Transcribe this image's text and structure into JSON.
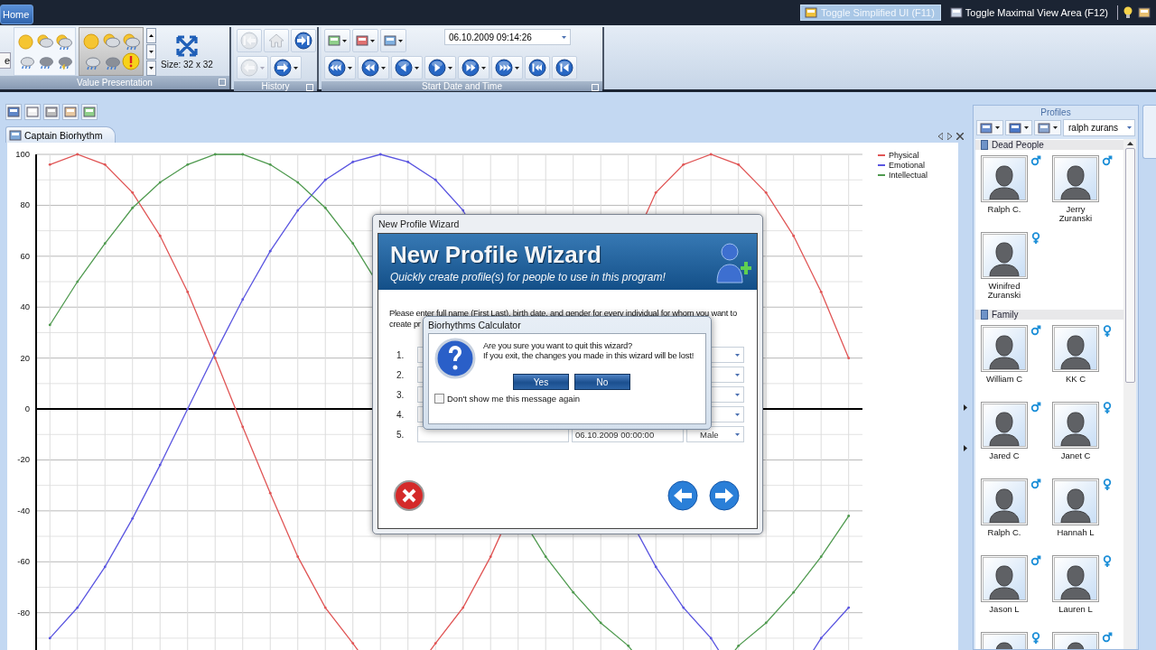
{
  "top_bar": {
    "home_tab": "Home",
    "toggle_simplified": "Toggle Simplified UI (F11)",
    "toggle_maximal": "Toggle Maximal View Area (F12)"
  },
  "ribbon": {
    "cut_button": "e",
    "value_presentation": {
      "label": "Value Presentation",
      "gallery": [
        {
          "selected": false
        },
        {
          "selected": true
        }
      ],
      "size": "Size: 32 x 32"
    },
    "history": {
      "label": "History",
      "buttons": [
        {
          "kind": "to-start",
          "disabled": true
        },
        {
          "kind": "home",
          "disabled": true
        },
        {
          "kind": "to-end",
          "disabled": false
        },
        {
          "kind": "back",
          "disabled": true
        },
        {
          "kind": "forward",
          "disabled": false
        }
      ]
    },
    "start_date_time": {
      "label": "Start Date and Time",
      "datetime": "06.10.2009 09:14:26"
    }
  },
  "document": {
    "tab": "Captain Biorhythm",
    "chart_data": {
      "type": "line",
      "categories": [
        null,
        null,
        null,
        null,
        null,
        null,
        null,
        null,
        null,
        null,
        null,
        null,
        null,
        null,
        null,
        null,
        null,
        null,
        null,
        null,
        null,
        null,
        null,
        null,
        null,
        null,
        null,
        null,
        null,
        null
      ],
      "ylim": [
        -95,
        100
      ],
      "yticks": [
        -80,
        -60,
        -40,
        -20,
        0,
        20,
        40,
        60,
        80,
        100
      ],
      "grid": true,
      "series": [
        {
          "name": "Physical",
          "color": "#e05555",
          "values": [
            96,
            100,
            96,
            85,
            68,
            46,
            20,
            -7,
            -33,
            -58,
            -78,
            -92,
            null,
            null,
            -92,
            -78,
            -58,
            null,
            null,
            null,
            null,
            null,
            85,
            96,
            100,
            96,
            85,
            68,
            46,
            20
          ]
        },
        {
          "name": "Emotional",
          "color": "#5a55e0",
          "values": [
            -90,
            -78,
            -62,
            -43,
            -22,
            0,
            22,
            43,
            62,
            78,
            90,
            97,
            100,
            97,
            90,
            78,
            null,
            null,
            null,
            null,
            null,
            null,
            -62,
            -78,
            -90,
            null,
            null,
            null,
            -90,
            -78
          ]
        },
        {
          "name": "Intellectual",
          "color": "#4f9a4f",
          "values": [
            33,
            50,
            65,
            79,
            89,
            96,
            100,
            100,
            96,
            89,
            79,
            65,
            null,
            null,
            null,
            null,
            null,
            null,
            -58,
            -72,
            -84,
            -93,
            null,
            null,
            null,
            -93,
            -84,
            -72,
            -58,
            -42
          ]
        }
      ]
    }
  },
  "profiles": {
    "title": "Profiles",
    "search": "ralph zurans",
    "groups": [
      {
        "name": "Dead People",
        "people": [
          {
            "name": "Ralph C.",
            "kind": "male"
          },
          {
            "name": "Jerry Zuranski",
            "kind": "male"
          },
          {
            "name": "Winifred Zuranski",
            "kind": "female"
          }
        ]
      },
      {
        "name": "Family",
        "people": [
          {
            "name": "William C",
            "kind": "male"
          },
          {
            "name": "KK C",
            "kind": "female"
          },
          {
            "name": "Jared C",
            "kind": "male"
          },
          {
            "name": "Janet C",
            "kind": "female"
          },
          {
            "name": "Ralph C.",
            "kind": "male"
          },
          {
            "name": "Hannah L",
            "kind": "female"
          },
          {
            "name": "Jason L",
            "kind": "male"
          },
          {
            "name": "Lauren L",
            "kind": "female"
          },
          {
            "kind": "female"
          },
          {
            "kind": "male"
          }
        ]
      }
    ]
  },
  "wizard": {
    "window_title": "New Profile Wizard",
    "heading": "New Profile Wizard",
    "subtitle": "Quickly create profile(s) for people to use in this program!",
    "instruction": [
      "Please enter full name (First Last), birth date, and gender for every individual for whom you want to",
      "create pr"
    ],
    "rows": [
      {
        "number": "1."
      },
      {
        "number": "2."
      },
      {
        "number": "3."
      },
      {
        "number": "4."
      },
      {
        "number": "5.",
        "date": "06.10.2009 00:00:00",
        "gender": "Male"
      }
    ]
  },
  "message_box": {
    "title": "Biorhythms Calculator",
    "lines": [
      "Are you sure you want to quit this wizard?",
      "If you exit, the changes you made in this wizard will be lost!"
    ],
    "buttons": [
      "Yes",
      "No"
    ],
    "checkbox": {
      "label": "Don't show me this message again",
      "checked": false
    }
  }
}
